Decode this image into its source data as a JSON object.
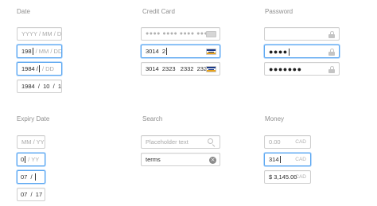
{
  "sections": {
    "date": {
      "heading": "Date",
      "placeholder": "YYYY / MM / DD",
      "typing1": {
        "value": "198",
        "rest": "/ MM / DD"
      },
      "typing2": {
        "year": "1984",
        "slash": "/",
        "rest": "/ DD"
      },
      "filled": {
        "year": "1984",
        "sep1": "/",
        "month": "10",
        "sep2": "/",
        "day": "18"
      }
    },
    "credit_card": {
      "heading": "Credit Card",
      "placeholder": "●●●● ●●●● ●●●● ●●●●",
      "typing": {
        "value": "3014  2"
      },
      "filled": {
        "value": "3014  2323   2332  2323"
      },
      "icons": {
        "generic": "card-icon",
        "visa": "visa-icon"
      }
    },
    "password": {
      "heading": "Password",
      "typing": {
        "masked": "●●●●"
      },
      "filled": {
        "masked": "●●●●●●●"
      },
      "icon": "lock-icon"
    },
    "expiry": {
      "heading": "Expiry Date",
      "placeholder": "MM / YY",
      "typing1": {
        "value": "0",
        "rest": "/ YY"
      },
      "typing2": {
        "value": "07",
        "slash": "/"
      },
      "filled": {
        "month": "07",
        "sep": "/",
        "year": "17"
      }
    },
    "search": {
      "heading": "Search",
      "placeholder": "Placeholder text",
      "filled": {
        "value": "terms"
      },
      "icons": {
        "search": "search-icon",
        "clear": "clear-icon",
        "clear_glyph": "×"
      }
    },
    "money": {
      "heading": "Money",
      "placeholder": "0.00",
      "currency": "CAD",
      "typing": {
        "value": "314"
      },
      "filled": {
        "value": "$ 3,145.00"
      }
    }
  },
  "colors": {
    "focus_border": "#5aa6f0",
    "field_border": "#cfcfcf",
    "heading_text": "#8f8f8f",
    "placeholder_text": "#a9a9a9"
  }
}
